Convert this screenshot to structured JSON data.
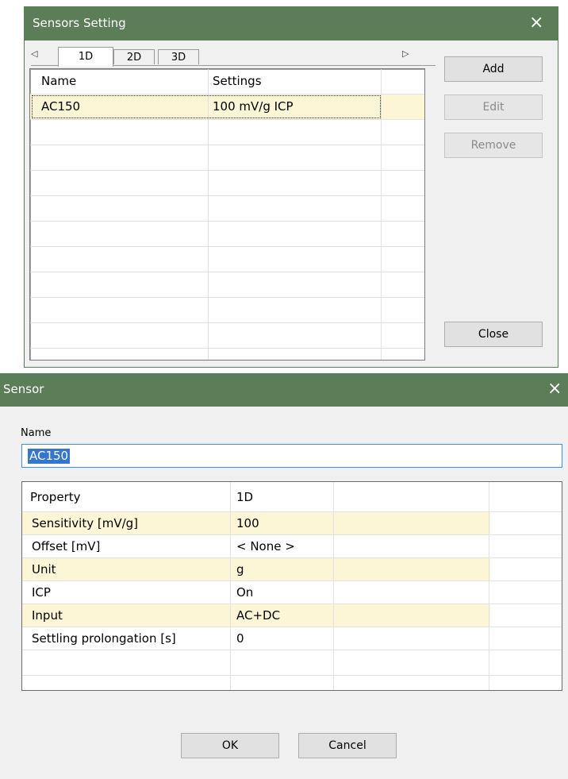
{
  "sensors_window": {
    "title": "Sensors Setting",
    "close_icon": "×",
    "tab_left_arrow": "◁",
    "tab_right_arrow": "▷",
    "tabs": [
      {
        "label": "1D",
        "active": true
      },
      {
        "label": "2D",
        "active": false
      },
      {
        "label": "3D",
        "active": false
      }
    ],
    "table": {
      "headers": [
        "Name",
        "Settings"
      ],
      "rows": [
        {
          "name": "AC150",
          "settings": "100 mV/g ICP",
          "selected": true
        }
      ]
    },
    "buttons": {
      "add": "Add",
      "edit": "Edit",
      "remove": "Remove",
      "close": "Close"
    },
    "colors": {
      "titlebar": "#5b7e58",
      "selected_row": "#fdf6d6"
    }
  },
  "sensor_dialog": {
    "title": "Sensor",
    "close_icon": "×",
    "name_label": "Name",
    "name_value": "AC150",
    "property_grid": {
      "headers": [
        "Property",
        "1D"
      ],
      "rows": [
        {
          "property": "Sensitivity [mV/g]",
          "value": "100",
          "highlighted": true
        },
        {
          "property": "Offset [mV]",
          "value": "< None >",
          "highlighted": false
        },
        {
          "property": "Unit",
          "value": "g",
          "highlighted": true
        },
        {
          "property": "ICP",
          "value": "On",
          "highlighted": false
        },
        {
          "property": "Input",
          "value": "AC+DC",
          "highlighted": true
        },
        {
          "property": "Settling prolongation [s]",
          "value": "0",
          "highlighted": false
        }
      ]
    },
    "buttons": {
      "ok": "OK",
      "cancel": "Cancel"
    }
  }
}
